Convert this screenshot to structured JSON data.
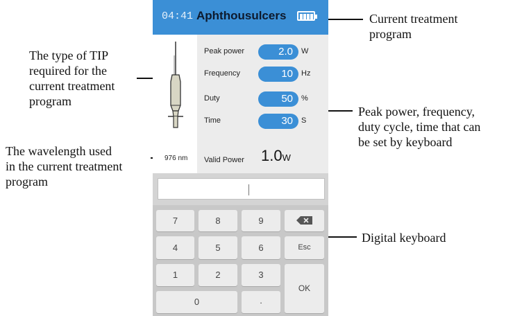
{
  "annotations": {
    "tip_type": "The type of TIP required for the current treatment program",
    "tip_type_lines": [
      "The type of TIP",
      "required for the",
      "current treatment",
      "program"
    ],
    "wavelength_lines": [
      "The wavelength used",
      "in the current treatment",
      "program"
    ],
    "program_lines": [
      "Current treatment",
      "program"
    ],
    "params_lines": [
      "Peak power, frequency,",
      "duty cycle, time that can",
      "be set by keyboard"
    ],
    "keyboard": "Digital keyboard"
  },
  "header": {
    "time": "04:41",
    "program": "Aphthousulcers",
    "battery_icon": "battery-full-icon"
  },
  "tip": {
    "icon": "handpiece-tip-icon",
    "wavelength": "976 nm"
  },
  "params": [
    {
      "label": "Peak power",
      "value": "2.0",
      "unit": "W"
    },
    {
      "label": "Frequency",
      "value": "10",
      "unit": "Hz"
    },
    {
      "label": "Duty",
      "value": "50",
      "unit": "%"
    },
    {
      "label": "Time",
      "value": "30",
      "unit": "S"
    }
  ],
  "valid_power": {
    "label": "Valid Power",
    "value": "1.0",
    "unit": "W"
  },
  "input": {
    "value": ""
  },
  "keypad": {
    "k7": "7",
    "k8": "8",
    "k9": "9",
    "backspace_icon": "backspace-icon",
    "k4": "4",
    "k5": "5",
    "k6": "6",
    "esc": "Esc",
    "k1": "1",
    "k2": "2",
    "k3": "3",
    "ok": "OK",
    "k0": "0",
    "dot": "."
  },
  "colors": {
    "accent": "#3b8fd6",
    "panel": "#ececec",
    "keypad_bg": "#c8c8c8"
  }
}
